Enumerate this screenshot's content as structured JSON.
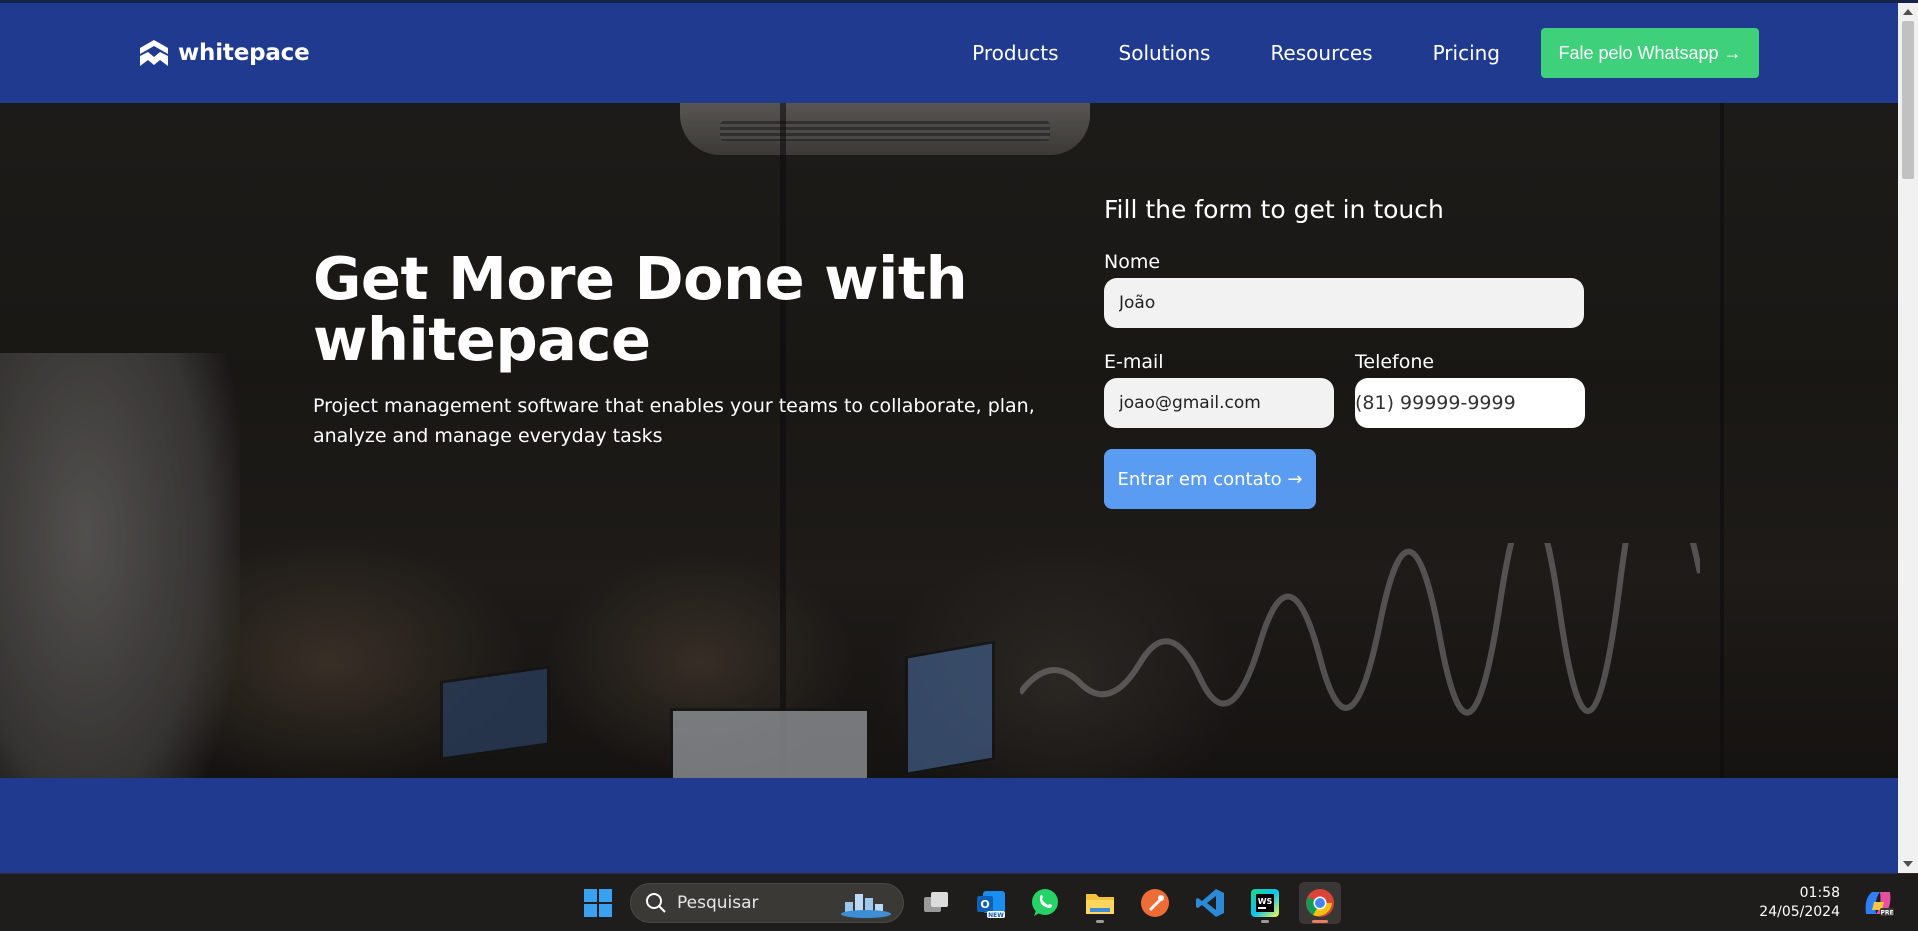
{
  "brand": {
    "name": "whitepace"
  },
  "nav": {
    "links": [
      "Products",
      "Solutions",
      "Resources",
      "Pricing"
    ],
    "cta": "Fale pelo Whatsapp →"
  },
  "hero": {
    "title": "Get More Done with whitepace",
    "subtitle": "Project management software that enables your teams to collaborate, plan, analyze and manage everyday tasks"
  },
  "form": {
    "title": "Fill the form to get in touch",
    "name_label": "Nome",
    "name_value": "João",
    "email_label": "E-mail",
    "email_value": "joao@gmail.com",
    "phone_label": "Telefone",
    "phone_value": "(81) 99999-9999",
    "submit": "Entrar em contato →"
  },
  "taskbar": {
    "search_placeholder": "Pesquisar",
    "apps": [
      "windows-start",
      "task-view",
      "outlook-new",
      "whatsapp",
      "file-explorer",
      "postman",
      "vscode",
      "webstorm",
      "chrome"
    ],
    "time": "01:58",
    "date": "24/05/2024"
  },
  "colors": {
    "nav_bg": "#1f3a8f",
    "cta_green": "#3ed07a",
    "submit_blue": "#5b9cf3"
  }
}
